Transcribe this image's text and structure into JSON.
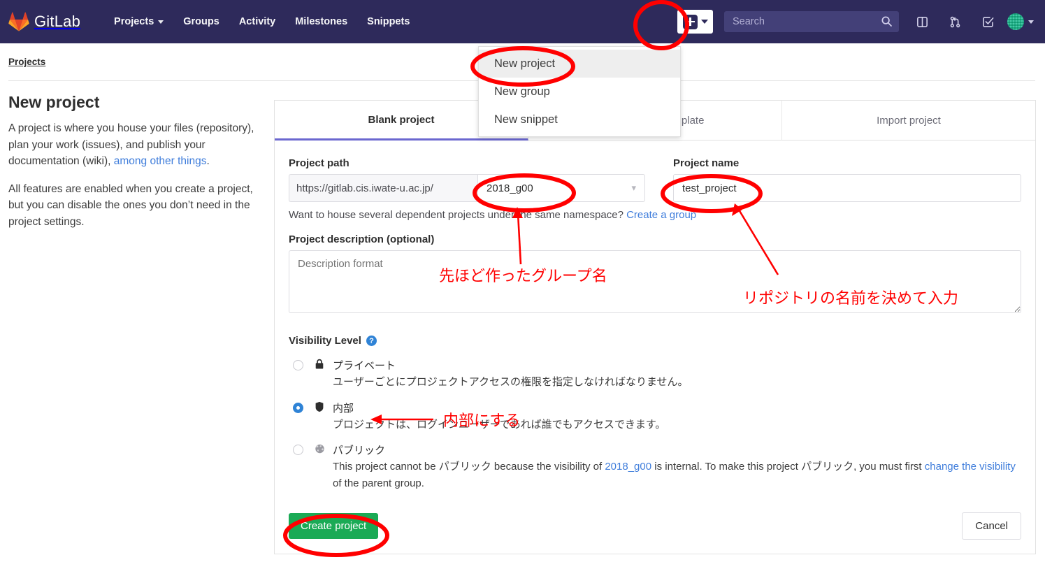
{
  "navbar": {
    "brand": "GitLab",
    "brand_icon": "gitlab-logo-icon",
    "links": [
      {
        "label": "Projects",
        "has_caret": true
      },
      {
        "label": "Groups",
        "has_caret": false
      },
      {
        "label": "Activity",
        "has_caret": false
      },
      {
        "label": "Milestones",
        "has_caret": false
      },
      {
        "label": "Snippets",
        "has_caret": false
      }
    ],
    "plus_button": {
      "icon": "plus-icon",
      "caret_icon": "chevron-down-icon"
    },
    "search": {
      "placeholder": "Search",
      "value": "",
      "icon": "search-icon"
    },
    "icons": [
      "issue-board-icon",
      "merge-request-icon",
      "todos-checkmark-icon"
    ],
    "avatar": {
      "name": "avatar",
      "caret_icon": "chevron-down-icon"
    }
  },
  "dropdown": {
    "items": [
      {
        "label": "New project",
        "highlighted": true
      },
      {
        "label": "New group",
        "highlighted": false
      },
      {
        "label": "New snippet",
        "highlighted": false
      }
    ]
  },
  "breadcrumb": {
    "text": "Projects"
  },
  "left": {
    "title": "New project",
    "p1_a": "A project is where you house your files (repository), plan your work (issues), and publish your documentation (wiki), ",
    "p1_link": "among other things",
    "p1_b": ".",
    "p2": "All features are enabled when you create a project, but you can disable the ones you don’t need in the project settings."
  },
  "panel": {
    "tabs": [
      {
        "label": "Blank project",
        "active": true
      },
      {
        "label": "Create from template",
        "active": false
      },
      {
        "label": "Import project",
        "active": false
      }
    ],
    "project_path": {
      "label": "Project path",
      "url_prefix": "https://gitlab.cis.iwate-u.ac.jp/",
      "namespace": "2018_g00",
      "caret_icon": "chevron-down-icon"
    },
    "project_name": {
      "label": "Project name",
      "value": "test_project",
      "placeholder": ""
    },
    "hint_text": "Want to house several dependent projects under the same namespace? ",
    "hint_link": "Create a group",
    "description": {
      "label": "Project description (optional)",
      "placeholder": "Description format",
      "value": ""
    },
    "visibility": {
      "title": "Visibility Level",
      "help_icon": "question-mark-icon",
      "options": [
        {
          "icon": "lock-icon",
          "title": "プライベート",
          "desc": "ユーザーごとにプロジェクトアクセスの権限を指定しなければなりません。",
          "selected": false
        },
        {
          "icon": "shield-icon",
          "title": "内部",
          "desc": "プロジェクトは、ログインユーザーであれば誰でもアクセスできます。",
          "selected": true
        },
        {
          "icon": "globe-icon",
          "title": "パブリック",
          "desc_parts": {
            "a": "This project cannot be パブリック because the visibility of ",
            "link1": "2018_g00",
            "b": " is internal. To make this project パブリック, you must first ",
            "link2": "change the visibility",
            "c": " of the parent group."
          },
          "selected": false
        }
      ]
    },
    "create_button": "Create project",
    "cancel_button": "Cancel"
  },
  "annotations": {
    "group_name_note": "先ほど作ったグループ名",
    "repo_name_note": "リポジトリの名前を決めて入力",
    "internal_note": "内部にする"
  },
  "colors": {
    "navbar_bg": "#2e2a5b",
    "accent_tab": "#6b67cf",
    "link": "#3f7ddb",
    "create_green": "#1aaa55",
    "annotation_red": "#ff0000",
    "radio_blue": "#2f83d6"
  }
}
